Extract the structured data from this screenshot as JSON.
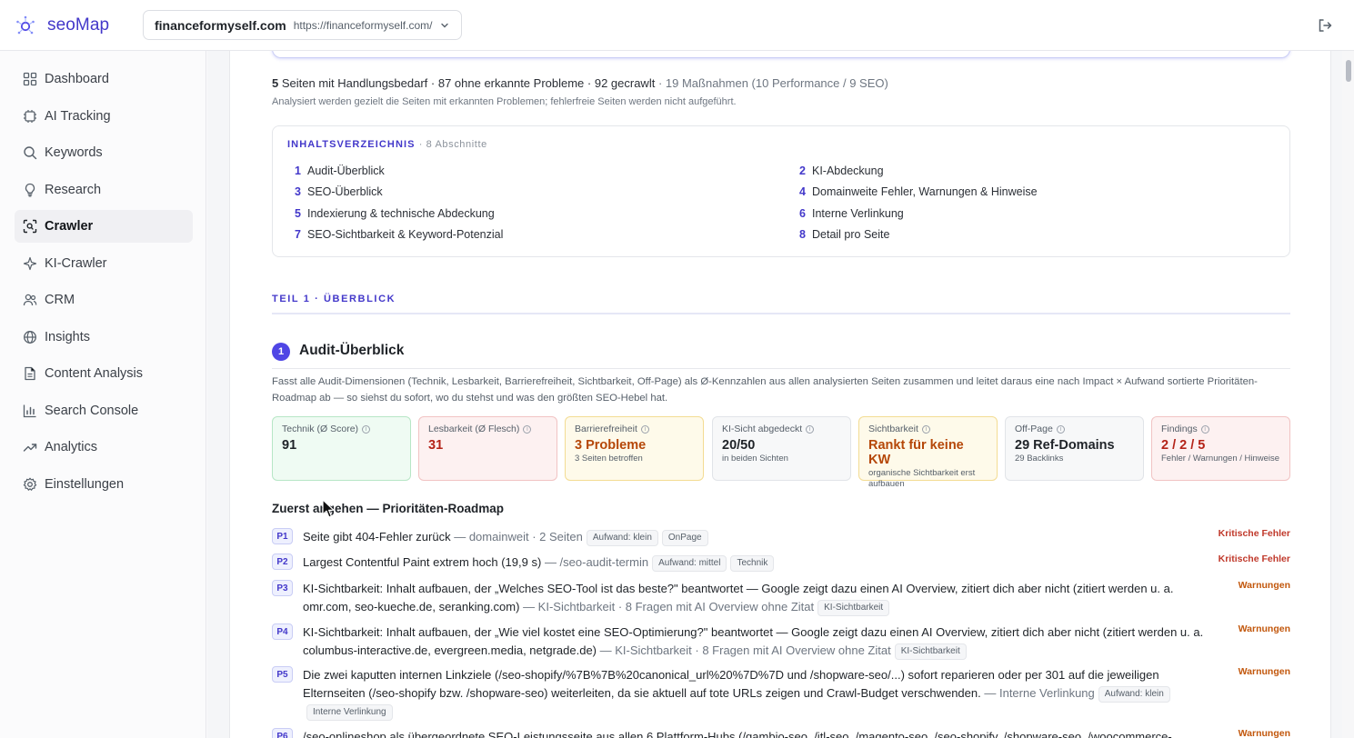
{
  "brand": {
    "name": "seoMap",
    "color": "#4338ca"
  },
  "site": {
    "domain": "financeformyself.com",
    "url": "https://financeformyself.com/"
  },
  "sidebar": {
    "items": [
      {
        "label": "Dashboard",
        "icon": "dashboard-icon",
        "active": false
      },
      {
        "label": "AI Tracking",
        "icon": "ai-tracking-icon",
        "active": false
      },
      {
        "label": "Keywords",
        "icon": "search-icon",
        "active": false
      },
      {
        "label": "Research",
        "icon": "lightbulb-icon",
        "active": false
      },
      {
        "label": "Crawler",
        "icon": "crawler-icon",
        "active": true
      },
      {
        "label": "KI-Crawler",
        "icon": "sparkle-icon",
        "active": false
      },
      {
        "label": "CRM",
        "icon": "users-icon",
        "active": false
      },
      {
        "label": "Insights",
        "icon": "globe-icon",
        "active": false
      },
      {
        "label": "Content Analysis",
        "icon": "document-icon",
        "active": false
      },
      {
        "label": "Search Console",
        "icon": "bar-chart-icon",
        "active": false
      },
      {
        "label": "Analytics",
        "icon": "trend-up-icon",
        "active": false
      },
      {
        "label": "Einstellungen",
        "icon": "gear-icon",
        "active": false
      }
    ]
  },
  "summary": {
    "pages_count": "5",
    "pages_text": "Seiten mit Handlungsbedarf · 87 ohne erkannte Probleme · 92 gecrawlt",
    "measures": "· 19 Maßnahmen (10 Performance / 9 SEO)",
    "note": "Analysiert werden gezielt die Seiten mit erkannten Problemen; fehlerfreie Seiten werden nicht aufgeführt."
  },
  "toc": {
    "title": "INHALTSVERZEICHNIS",
    "count": "· 8 Abschnitte",
    "items": [
      {
        "num": "1",
        "label": "Audit-Überblick"
      },
      {
        "num": "2",
        "label": "KI-Abdeckung"
      },
      {
        "num": "3",
        "label": "SEO-Überblick"
      },
      {
        "num": "4",
        "label": "Domainweite Fehler, Warnungen & Hinweise"
      },
      {
        "num": "5",
        "label": "Indexierung & technische Abdeckung"
      },
      {
        "num": "6",
        "label": "Interne Verlinkung"
      },
      {
        "num": "7",
        "label": "SEO-Sichtbarkeit & Keyword-Potenzial"
      },
      {
        "num": "8",
        "label": "Detail pro Seite"
      }
    ]
  },
  "part": {
    "label": "TEIL 1 · ÜBERBLICK"
  },
  "section": {
    "num": "1",
    "title": "Audit-Überblick",
    "description": "Fasst alle Audit-Dimensionen (Technik, Lesbarkeit, Barrierefreiheit, Sichtbarkeit, Off-Page) als Ø-Kennzahlen aus allen analysierten Seiten zusammen und leitet daraus eine nach Impact × Aufwand sortierte Prioritäten-Roadmap ab — so siehst du sofort, wo du stehst und was den größten SEO-Hebel hat."
  },
  "kpis": [
    {
      "label": "Technik (Ø Score)",
      "value": "91",
      "sub": "",
      "tone": "green"
    },
    {
      "label": "Lesbarkeit (Ø Flesch)",
      "value": "31",
      "sub": "",
      "tone": "red"
    },
    {
      "label": "Barrierefreiheit",
      "value": "3 Probleme",
      "sub": "3 Seiten betroffen",
      "tone": "amber"
    },
    {
      "label": "KI-Sicht abgedeckt",
      "value": "20/50",
      "sub": "in beiden Sichten",
      "tone": "gray"
    },
    {
      "label": "Sichtbarkeit",
      "value": "Rankt für keine KW",
      "sub": "organische Sichtbarkeit erst aufbauen",
      "tone": "amber"
    },
    {
      "label": "Off-Page",
      "value": "29 Ref-Domains",
      "sub": "29 Backlinks",
      "tone": "gray"
    },
    {
      "label": "Findings",
      "value": "2 / 2 / 5",
      "sub": "Fehler / Warnungen / Hinweise",
      "tone": "red"
    }
  ],
  "tone_colors": {
    "green": {
      "bg": "#effbf3",
      "border": "#b7e6c6",
      "value": "#1f2328"
    },
    "red": {
      "bg": "#fdf1f1",
      "border": "#f1c3c3",
      "value": "#b42318"
    },
    "amber": {
      "bg": "#fefaea",
      "border": "#f3dc93",
      "value": "#b54708"
    },
    "gray": {
      "bg": "#f7f8f9",
      "border": "#e1e4e8",
      "value": "#1f2328"
    }
  },
  "roadmap": {
    "title": "Zuerst angehen — Prioritäten-Roadmap",
    "items": [
      {
        "id": "P1",
        "text": "Seite gibt 404-Fehler zurück",
        "meta": "— domainweit · 2 Seiten",
        "tags": [
          "Aufwand: klein",
          "OnPage"
        ],
        "category": "Kritische Fehler",
        "severity": "crit"
      },
      {
        "id": "P2",
        "text": "Largest Contentful Paint extrem hoch (19,9 s)",
        "meta": "— /seo-audit-termin",
        "tags": [
          "Aufwand: mittel",
          "Technik"
        ],
        "category": "Kritische Fehler",
        "severity": "crit"
      },
      {
        "id": "P3",
        "text": "KI-Sichtbarkeit: Inhalt aufbauen, der „Welches SEO-Tool ist das beste?\" beantwortet — Google zeigt dazu einen AI Overview, zitiert dich aber nicht (zitiert werden u. a. omr.com, seo-kueche.de, seranking.com)",
        "meta": "— KI-Sichtbarkeit · 8 Fragen mit AI Overview ohne Zitat",
        "tags": [
          "KI-Sichtbarkeit"
        ],
        "category": "Warnungen",
        "severity": "warn"
      },
      {
        "id": "P4",
        "text": "KI-Sichtbarkeit: Inhalt aufbauen, der „Wie viel kostet eine SEO-Optimierung?\" beantwortet — Google zeigt dazu einen AI Overview, zitiert dich aber nicht (zitiert werden u. a. columbus-interactive.de, evergreen.media, netgrade.de)",
        "meta": "— KI-Sichtbarkeit · 8 Fragen mit AI Overview ohne Zitat",
        "tags": [
          "KI-Sichtbarkeit"
        ],
        "category": "Warnungen",
        "severity": "warn"
      },
      {
        "id": "P5",
        "text": "Die zwei kaputten internen Linkziele (/seo-shopify/%7B%7B%20canonical_url%20%7D%7D und /shopware-seo/...) sofort reparieren oder per 301 auf die jeweiligen Elternseiten (/seo-shopify bzw. /shopware-seo) weiterleiten, da sie aktuell auf tote URLs zeigen und Crawl-Budget verschwenden.",
        "meta": "— Interne Verlinkung",
        "tags": [
          "Aufwand: klein",
          "Interne Verlinkung"
        ],
        "category": "Warnungen",
        "severity": "warn"
      },
      {
        "id": "P6",
        "text": "/seo-onlineshop als übergeordnete SEO-Leistungsseite aus allen 6 Plattform-Hubs (/gambio-seo, /jtl-seo, /magento-seo, /seo-shopify, /shopware-seo, /woocommerce-",
        "meta": "",
        "tags": [],
        "category": "Warnungen",
        "severity": "warn"
      }
    ]
  }
}
